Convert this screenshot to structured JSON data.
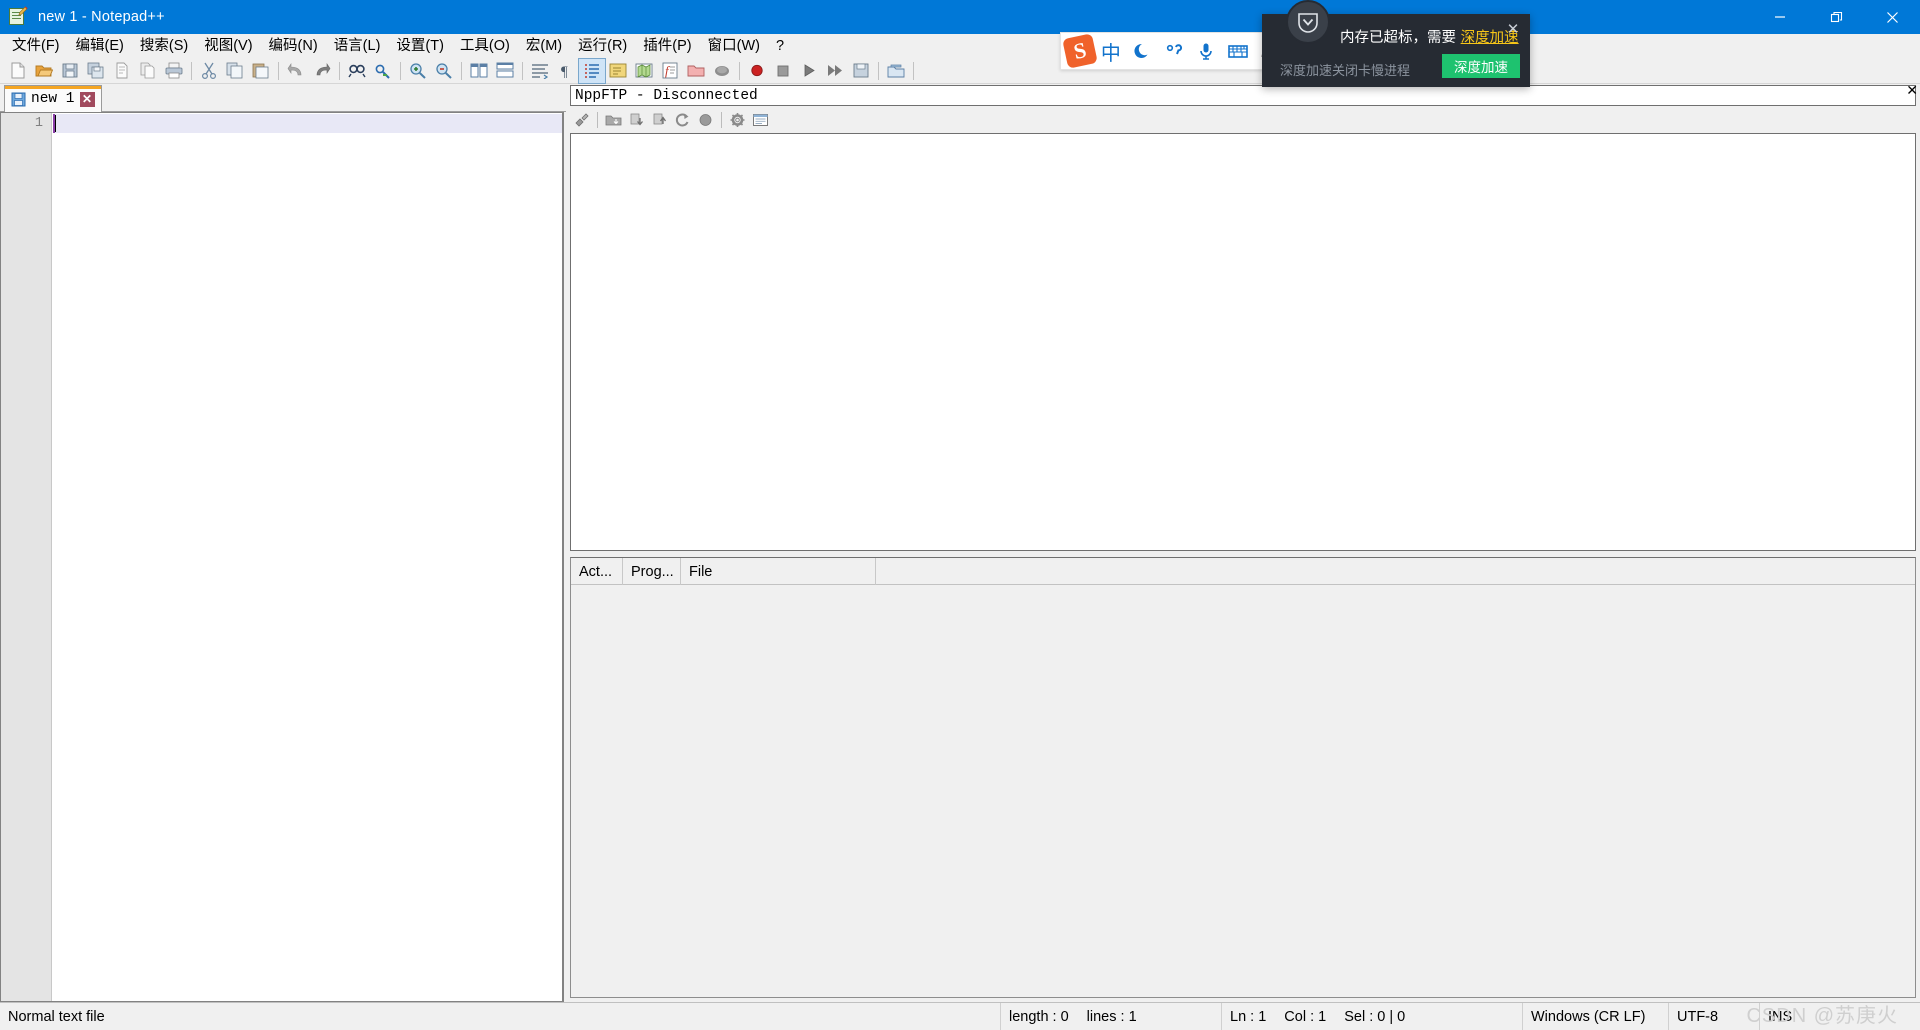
{
  "window": {
    "title": "new 1 - Notepad++",
    "icon": "notepad-plus-plus-icon",
    "controls": {
      "minimize": "—",
      "restore": "❐",
      "close": "✕"
    }
  },
  "menu": {
    "items": [
      {
        "label": "文件(F)"
      },
      {
        "label": "编辑(E)"
      },
      {
        "label": "搜索(S)"
      },
      {
        "label": "视图(V)"
      },
      {
        "label": "编码(N)"
      },
      {
        "label": "语言(L)"
      },
      {
        "label": "设置(T)"
      },
      {
        "label": "工具(O)"
      },
      {
        "label": "宏(M)"
      },
      {
        "label": "运行(R)"
      },
      {
        "label": "插件(P)"
      },
      {
        "label": "窗口(W)"
      },
      {
        "label": "?"
      }
    ]
  },
  "toolbar": {
    "buttons": [
      {
        "name": "new-file",
        "title": "New"
      },
      {
        "name": "open-file",
        "title": "Open"
      },
      {
        "name": "save-file",
        "title": "Save"
      },
      {
        "name": "save-all",
        "title": "Save All"
      },
      {
        "name": "close-file",
        "title": "Close"
      },
      {
        "name": "close-all",
        "title": "Close All"
      },
      {
        "name": "print",
        "title": "Print"
      },
      {
        "sep": true
      },
      {
        "name": "cut",
        "title": "Cut"
      },
      {
        "name": "copy",
        "title": "Copy"
      },
      {
        "name": "paste",
        "title": "Paste"
      },
      {
        "sep": true
      },
      {
        "name": "undo",
        "title": "Undo"
      },
      {
        "name": "redo",
        "title": "Redo"
      },
      {
        "sep": true
      },
      {
        "name": "find",
        "title": "Find"
      },
      {
        "name": "replace",
        "title": "Replace"
      },
      {
        "sep": true
      },
      {
        "name": "zoom-in",
        "title": "Zoom In"
      },
      {
        "name": "zoom-out",
        "title": "Zoom Out"
      },
      {
        "sep": true
      },
      {
        "name": "sync-vertical-scroll",
        "title": "Sync Vertical Scrolling"
      },
      {
        "name": "sync-horizontal-scroll",
        "title": "Sync Horizontal Scrolling"
      },
      {
        "sep": true
      },
      {
        "name": "word-wrap",
        "title": "Word Wrap"
      },
      {
        "name": "show-all-chars",
        "title": "Show All Characters"
      },
      {
        "name": "show-indent-guide",
        "title": "Show Indent Guide",
        "active": true
      },
      {
        "name": "user-defined-dialog",
        "title": "User Defined Dialogue"
      },
      {
        "name": "document-map",
        "title": "Document Map"
      },
      {
        "name": "function-list",
        "title": "Function List"
      },
      {
        "name": "folder-as-workspace",
        "title": "Folder as Workspace"
      },
      {
        "name": "monitoring",
        "title": "Monitoring"
      },
      {
        "sep": true
      },
      {
        "name": "macro-record",
        "title": "Start Recording"
      },
      {
        "name": "macro-stop",
        "title": "Stop Recording"
      },
      {
        "name": "macro-playback",
        "title": "Playback"
      },
      {
        "name": "macro-run-multiple",
        "title": "Run a Macro Multiple Times"
      },
      {
        "name": "macro-save",
        "title": "Save Current Recorded Macro"
      },
      {
        "sep": true
      },
      {
        "name": "run-npp-ftp",
        "title": "NppFTP"
      }
    ]
  },
  "tabs": [
    {
      "label": "new 1",
      "icon": "save-blue-icon",
      "close": "✕",
      "active": true
    }
  ],
  "editor": {
    "line_numbers": [
      "1"
    ],
    "content": ""
  },
  "ftp_panel": {
    "title": "NppFTP - Disconnected",
    "close_label": "✕",
    "toolbar": [
      {
        "name": "connect-icon",
        "title": "(Dis)connect"
      },
      {
        "sep": true
      },
      {
        "name": "download-folder-icon",
        "title": "Download"
      },
      {
        "name": "download-file-icon",
        "title": "Download file"
      },
      {
        "name": "upload-file-icon",
        "title": "Upload file"
      },
      {
        "name": "refresh-icon",
        "title": "Refresh"
      },
      {
        "name": "abort-icon",
        "title": "Abort"
      },
      {
        "sep": true
      },
      {
        "name": "settings-gear-icon",
        "title": "Settings"
      },
      {
        "name": "messages-window-icon",
        "title": "Messages"
      }
    ],
    "columns": [
      {
        "label": "Act..."
      },
      {
        "label": "Prog..."
      },
      {
        "label": "File"
      }
    ],
    "rows": []
  },
  "statusbar": {
    "file_type": "Normal text file",
    "length_label": "length : 0",
    "lines_label": "lines : 1",
    "ln": "Ln : 1",
    "col": "Col : 1",
    "sel": "Sel : 0 | 0",
    "eol": "Windows (CR LF)",
    "encoding": "UTF-8",
    "insert_mode": "INS"
  },
  "ime": {
    "logo": "sogou-logo",
    "items": [
      {
        "name": "ime-mode-chinese",
        "label": "中"
      },
      {
        "name": "ime-moon-icon",
        "label": ""
      },
      {
        "name": "ime-punctuation-icon",
        "label": ""
      },
      {
        "name": "ime-voice-icon",
        "label": ""
      },
      {
        "name": "ime-keyboard-icon",
        "label": ""
      },
      {
        "name": "ime-account-icon",
        "label": ""
      },
      {
        "name": "ime-skin-icon",
        "label": ""
      },
      {
        "name": "ime-toolbox-icon",
        "label": ""
      }
    ]
  },
  "notification": {
    "avatar": "shield-v-icon",
    "title_prefix": "内存已超标，需要 ",
    "title_highlight": "深度加速",
    "subtitle": "深度加速关闭卡慢进程",
    "button_label": "深度加速",
    "close_label": "✕",
    "accent_color": "#1ec26f",
    "highlight_color": "#f5c518",
    "background_color": "#262b33"
  },
  "watermark": {
    "text": "CSDN @苏庚火"
  },
  "colors": {
    "title_bar": "#0078d7",
    "chrome": "#f0f0f0",
    "tab_accent": "#f5a623",
    "current_line": "#e8e8f6"
  }
}
